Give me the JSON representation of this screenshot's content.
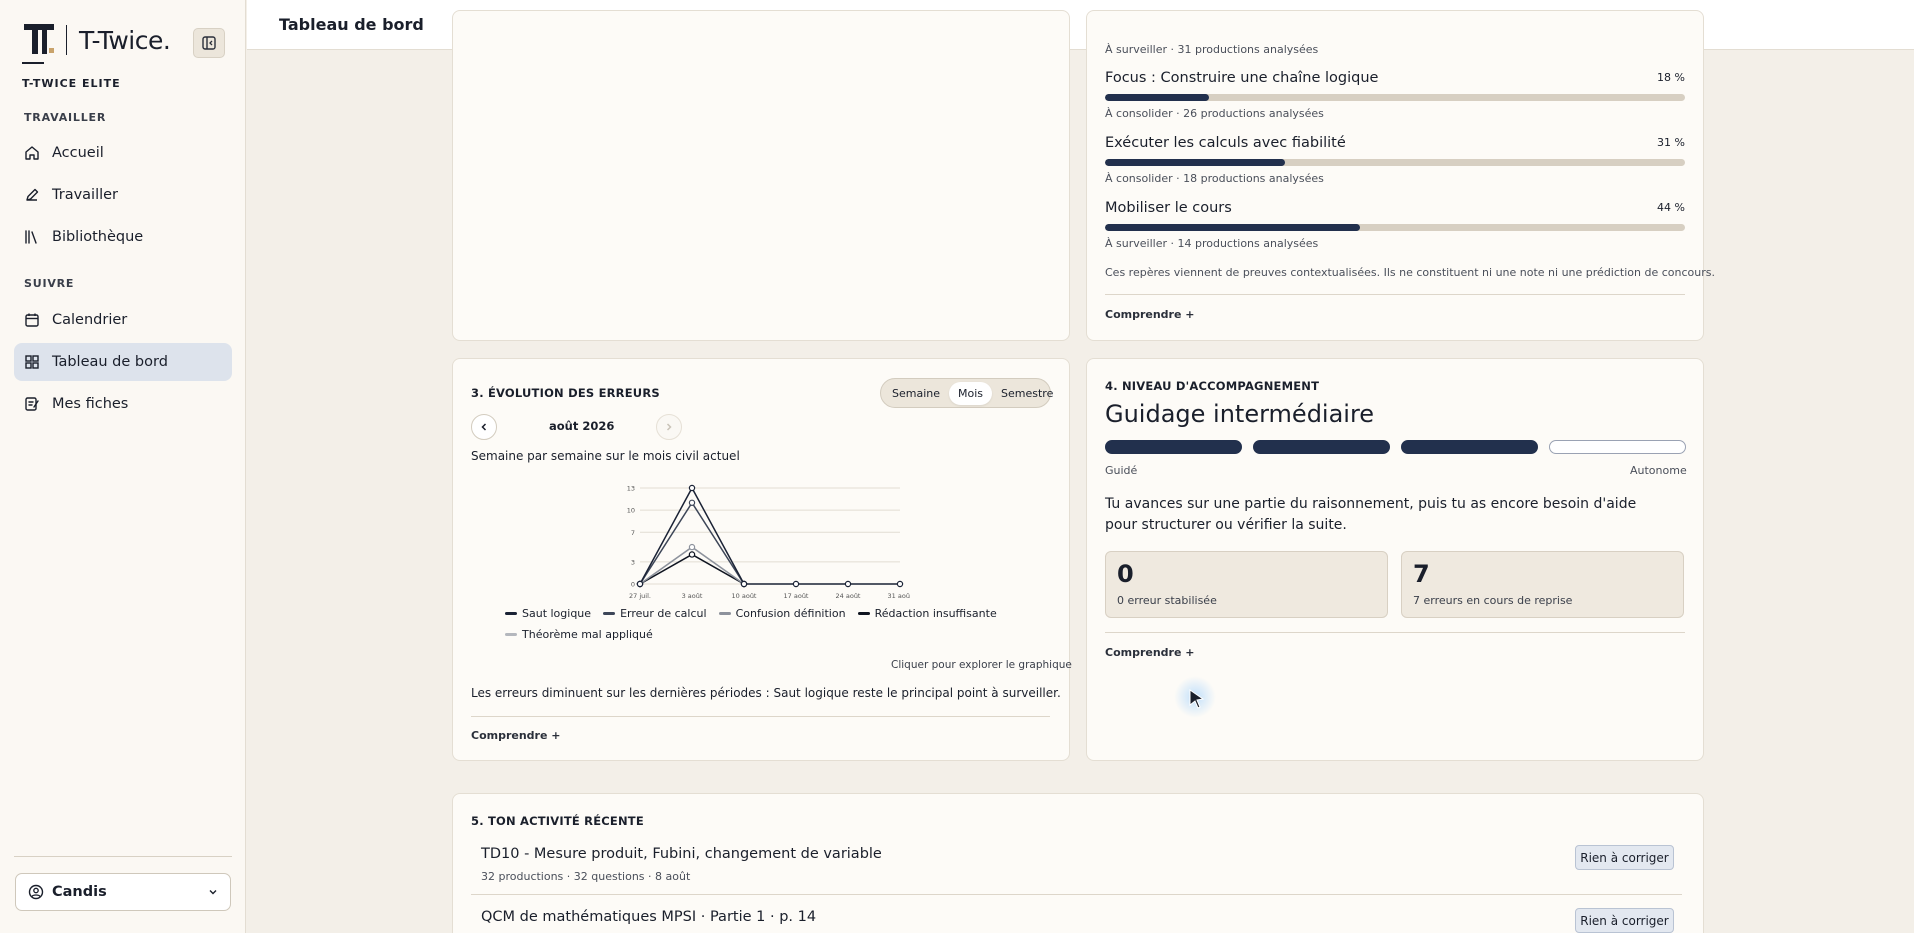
{
  "brand": {
    "name": "T-Twice.",
    "plan": "T-TWICE ELITE"
  },
  "sidebar": {
    "sections": [
      {
        "label": "TRAVAILLER"
      },
      {
        "label": "SUIVRE"
      }
    ],
    "items": [
      {
        "label": "Accueil",
        "icon": "home-icon"
      },
      {
        "label": "Travailler",
        "icon": "pencil-icon"
      },
      {
        "label": "Bibliothèque",
        "icon": "library-icon"
      },
      {
        "label": "Calendrier",
        "icon": "calendar-icon"
      },
      {
        "label": "Tableau de bord",
        "icon": "dashboard-icon",
        "active": true
      },
      {
        "label": "Mes fiches",
        "icon": "notes-icon"
      }
    ],
    "user": {
      "name": "Candis"
    }
  },
  "header": {
    "title": "Tableau de bord"
  },
  "skills": {
    "top_meta": "À surveiller · 31 productions analysées",
    "items": [
      {
        "name": "Focus : Construire une chaîne logique",
        "pct_label": "18 %",
        "value": 18,
        "meta": "À consolider · 26 productions analysées"
      },
      {
        "name": "Exécuter les calculs avec fiabilité",
        "pct_label": "31 %",
        "value": 31,
        "meta": "À consolider · 18 productions analysées"
      },
      {
        "name": "Mobiliser le cours",
        "pct_label": "44 %",
        "value": 44,
        "meta": "À surveiller · 14 productions analysées"
      }
    ],
    "disclaimer": "Ces repères viennent de preuves contextualisées. Ils ne constituent ni une note ni une prédiction de concours.",
    "comprendre": "Comprendre +"
  },
  "errors": {
    "title": "3. ÉVOLUTION DES ERREURS",
    "tabs": [
      "Semaine",
      "Mois",
      "Semestre"
    ],
    "active_tab": "Mois",
    "month": "août 2026",
    "subtitle": "Semaine par semaine sur le mois civil actuel",
    "explore": "Cliquer pour explorer le graphique",
    "summary": "Les erreurs diminuent sur les dernières périodes : Saut logique reste le principal point à surveiller.",
    "comprendre": "Comprendre +"
  },
  "chart_data": {
    "type": "line",
    "x": [
      "27 juil.",
      "3 août",
      "10 août",
      "17 août",
      "24 août",
      "31 août"
    ],
    "yticks": [
      "0",
      "3",
      "7",
      "10",
      "13"
    ],
    "ylim": [
      0,
      13
    ],
    "series": [
      {
        "name": "Saut logique",
        "color": "#1a2235",
        "values": [
          0,
          13,
          0,
          0,
          0,
          0
        ]
      },
      {
        "name": "Erreur de calcul",
        "color": "#3d4658",
        "values": [
          0,
          11,
          0,
          null,
          null,
          null
        ]
      },
      {
        "name": "Confusion définition",
        "color": "#8d929c",
        "values": [
          0,
          5,
          0,
          null,
          null,
          null
        ]
      },
      {
        "name": "Rédaction insuffisante",
        "color": "#0f1420",
        "values": [
          0,
          4,
          0,
          null,
          null,
          null
        ]
      },
      {
        "name": "Théorème mal appliqué",
        "color": "#b4b7bd",
        "values": [
          0,
          4,
          0,
          null,
          null,
          null
        ]
      }
    ]
  },
  "accompagnement": {
    "title": "4. NIVEAU D'ACCOMPAGNEMENT",
    "level": "Guidage intermédiaire",
    "filled": 3,
    "total": 4,
    "left_label": "Guidé",
    "right_label": "Autonome",
    "description": "Tu avances sur une partie du raisonnement, puis tu as encore besoin d'aide pour structurer ou vérifier la suite.",
    "stats": [
      {
        "value": "0",
        "label": "0 erreur stabilisée"
      },
      {
        "value": "7",
        "label": "7 erreurs en cours de reprise"
      }
    ],
    "comprendre": "Comprendre +"
  },
  "activity": {
    "title": "5. TON ACTIVITÉ RÉCENTE",
    "items": [
      {
        "title": "TD10 - Mesure produit, Fubini, changement de variable",
        "meta": "32 productions · 32 questions · 8 août",
        "badge": "Rien à corriger"
      },
      {
        "title": "QCM de mathématiques MPSI · Partie 1 · p. 14",
        "meta": "",
        "badge": "Rien à corriger"
      }
    ]
  }
}
